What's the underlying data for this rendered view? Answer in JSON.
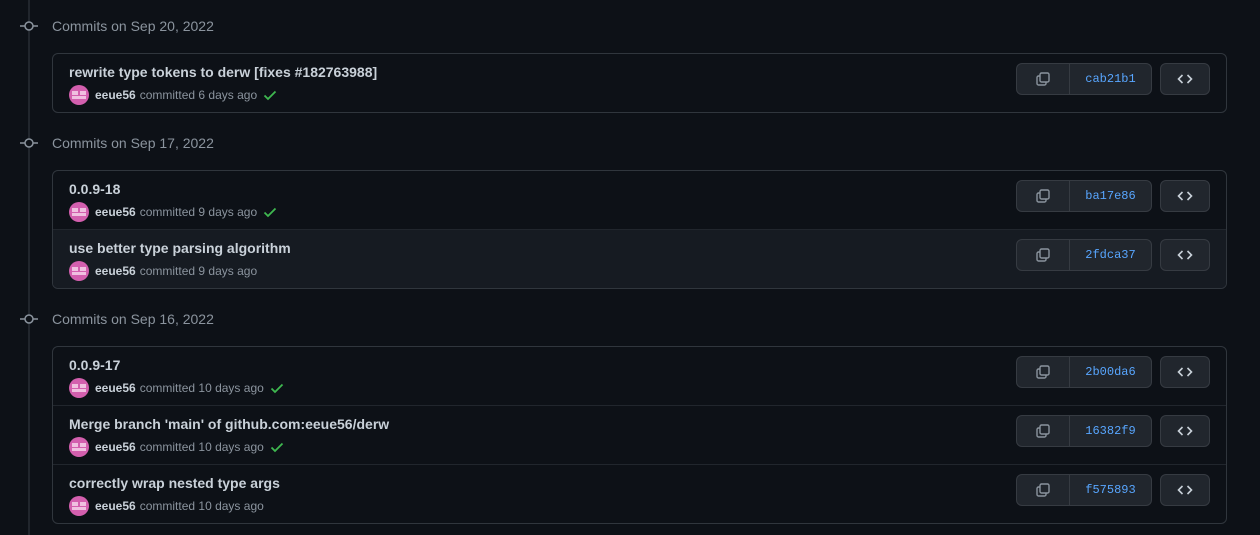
{
  "groups": [
    {
      "title": "Commits on Sep 20, 2022",
      "commits": [
        {
          "message": "rewrite type tokens to derw [fixes #182763988]",
          "author": "eeue56",
          "action": "committed",
          "time": "6 days ago",
          "verified": true,
          "sha": "cab21b1"
        }
      ]
    },
    {
      "title": "Commits on Sep 17, 2022",
      "commits": [
        {
          "message": "0.0.9-18",
          "author": "eeue56",
          "action": "committed",
          "time": "9 days ago",
          "verified": true,
          "sha": "ba17e86"
        },
        {
          "message": "use better type parsing algorithm",
          "author": "eeue56",
          "action": "committed",
          "time": "9 days ago",
          "verified": false,
          "sha": "2fdca37"
        }
      ]
    },
    {
      "title": "Commits on Sep 16, 2022",
      "commits": [
        {
          "message": "0.0.9-17",
          "author": "eeue56",
          "action": "committed",
          "time": "10 days ago",
          "verified": true,
          "sha": "2b00da6"
        },
        {
          "message": "Merge branch 'main' of github.com:eeue56/derw",
          "author": "eeue56",
          "action": "committed",
          "time": "10 days ago",
          "verified": true,
          "sha": "16382f9"
        },
        {
          "message": "correctly wrap nested type args",
          "author": "eeue56",
          "action": "committed",
          "time": "10 days ago",
          "verified": false,
          "sha": "f575893"
        }
      ]
    }
  ],
  "colors": {
    "accent": "#58a6ff",
    "success": "#3fb950",
    "avatar": "#d35fae"
  },
  "icons": {
    "node": "git-commit-icon",
    "copy": "copy-icon",
    "browse": "code-icon",
    "status": "check-icon"
  }
}
